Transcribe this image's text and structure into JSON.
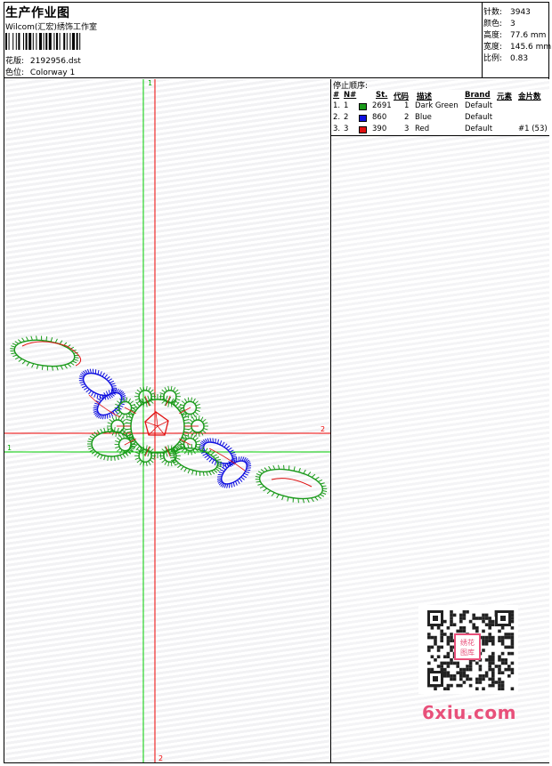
{
  "header": {
    "title": "生产作业图",
    "company": "Wilcom(汇宏)绣饰工作室",
    "design_label": "花版:",
    "design_value": "2192956.dst",
    "colorway_label": "色位:",
    "colorway_value": "Colorway 1"
  },
  "stats": [
    {
      "label": "针数:",
      "value": "3943"
    },
    {
      "label": "颜色:",
      "value": "3"
    },
    {
      "label": "高度:",
      "value": "77.6 mm"
    },
    {
      "label": "宽度:",
      "value": "145.6 mm"
    },
    {
      "label": "比例:",
      "value": "0.83"
    }
  ],
  "guides": {
    "vertical_green_label": "1",
    "vertical_red_label": "2",
    "horizontal_green_label": "1",
    "horizontal_red_label": "2"
  },
  "stops": {
    "heading": "停止顺序:",
    "columns": [
      "#",
      "N#",
      "St.",
      "代码",
      "描述",
      "Brand",
      "元素",
      "金片数"
    ],
    "rows": [
      {
        "num": "1.",
        "n": "1",
        "color": "#1a9a1a",
        "st": "2691",
        "code": "1",
        "desc": "Dark Green",
        "brand": "Default",
        "elem": "",
        "seq": ""
      },
      {
        "num": "2.",
        "n": "2",
        "color": "#1010e0",
        "st": "860",
        "code": "2",
        "desc": "Blue",
        "brand": "Default",
        "elem": "",
        "seq": ""
      },
      {
        "num": "3.",
        "n": "3",
        "color": "#e01010",
        "st": "390",
        "code": "3",
        "desc": "Red",
        "brand": "Default",
        "elem": "",
        "seq": "#1 (53)"
      }
    ]
  },
  "watermark": {
    "qr_stamp": "绣花图库",
    "site": "6xiu.com"
  },
  "colors": {
    "green": "#1a9a1a",
    "blue": "#1010e0",
    "red": "#e01010",
    "guide_green": "#00cc00",
    "guide_red": "#ee0000"
  }
}
